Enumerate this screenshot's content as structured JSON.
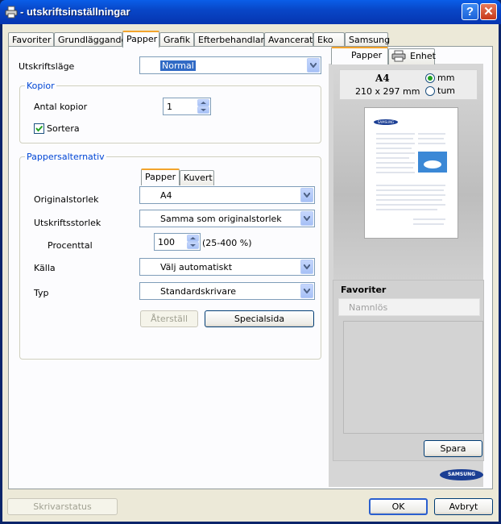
{
  "window": {
    "title": "- utskriftsinställningar",
    "help_label": "?",
    "close_label": "✕"
  },
  "tabs": [
    {
      "label": "Favoriter"
    },
    {
      "label": "Grundläggande"
    },
    {
      "label": "Papper"
    },
    {
      "label": "Grafik"
    },
    {
      "label": "Efterbehandlar"
    },
    {
      "label": "Avancerat"
    },
    {
      "label": "Eko"
    },
    {
      "label": "Samsung"
    }
  ],
  "print_mode": {
    "label": "Utskriftsläge",
    "value": "Normal"
  },
  "copies": {
    "group_title": "Kopior",
    "count_label": "Antal kopior",
    "count_value": "1",
    "collate_label": "Sortera",
    "collate_checked": true
  },
  "paper_options": {
    "group_title": "Pappersalternativ",
    "subtabs": [
      {
        "label": "Papper"
      },
      {
        "label": "Kuvert"
      }
    ],
    "original_size_label": "Originalstorlek",
    "original_size_value": "A4",
    "output_size_label": "Utskriftsstorlek",
    "output_size_value": "Samma som originalstorlek",
    "percent_label": "Procenttal",
    "percent_value": "100",
    "percent_range": "(25-400 %)",
    "source_label": "Källa",
    "source_value": "Välj automatiskt",
    "type_label": "Typ",
    "type_value": "Standardskrivare",
    "reset_label": "Återställ",
    "custom_label": "Specialsida"
  },
  "preview": {
    "tabs": [
      {
        "label": "Papper"
      },
      {
        "label": "Enhet"
      }
    ],
    "size_name": "A4",
    "size_dims": "210 x 297 mm",
    "unit_mm": "mm",
    "unit_inch": "tum",
    "unit_selected": "mm",
    "doc_logo": "SAMSUNG"
  },
  "favorites": {
    "title": "Favoriter",
    "input_placeholder": "Namnlös",
    "save_label": "Spara"
  },
  "brand_logo": "SAMSUNG",
  "footer": {
    "printer_status_label": "Skrivarstatus",
    "ok_label": "OK",
    "cancel_label": "Avbryt"
  },
  "colors": {
    "accent": "#0046d5",
    "titlebar": "#0847c8",
    "face": "#ece9d8"
  }
}
